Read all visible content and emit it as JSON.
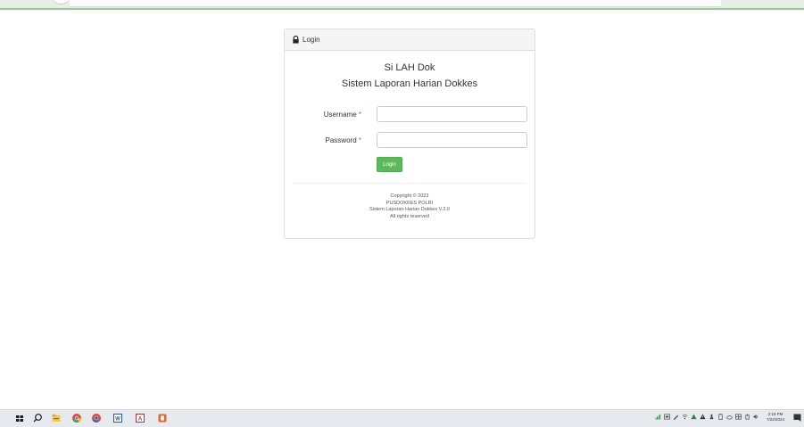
{
  "panel": {
    "heading": "Login",
    "app_title": "Si LAH Dok",
    "app_subtitle": "Sistem Laporan Harian Dokkes",
    "username_label": "Username",
    "password_label": "Password",
    "required_mark": "*",
    "login_button": "Login",
    "footer": {
      "line1": "Copyright © 2023",
      "line2": "PUSDOKKES POLRI",
      "line3": "Sistem Laporan Harian Dokkes V.2.0",
      "line4": "All rights reserved"
    }
  },
  "taskbar": {
    "icons": [
      "windows-start-icon",
      "search-icon",
      "file-explorer-icon",
      "chrome-icon",
      "chrome-canary-icon",
      "word-icon",
      "access-icon",
      "app-icon"
    ],
    "tray_icons": [
      "network-signal-icon",
      "tray-app-icon",
      "pen-icon",
      "wifi-icon",
      "drive-icon",
      "alert-icon",
      "usb-icon",
      "battery-icon",
      "cloud-icon",
      "language-icon",
      "power-icon",
      "volume-icon"
    ],
    "time": "2:18 PM",
    "date": "7/22/2024"
  },
  "colors": {
    "primary_button": "#5cb85c",
    "required": "#d9534f",
    "panel_border": "#dddddd",
    "panel_heading_bg": "#f5f5f5"
  }
}
